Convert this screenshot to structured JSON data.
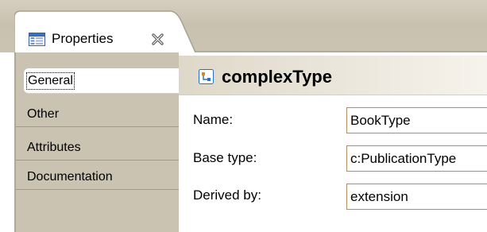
{
  "view": {
    "tab_label": "Properties",
    "tab_icon": "properties-view-icon",
    "close_icon": "close-icon"
  },
  "side_tabs": [
    {
      "label": "General",
      "active": true
    },
    {
      "label": "Other",
      "active": false
    },
    {
      "label": "Attributes",
      "active": false
    },
    {
      "label": "Documentation",
      "active": false
    }
  ],
  "section": {
    "icon": "complex-type-icon",
    "title": "complexType"
  },
  "fields": {
    "name": {
      "label": "Name:",
      "value": "BookType"
    },
    "base_type": {
      "label": "Base type:",
      "value": "c:PublicationType"
    },
    "derived_by": {
      "label": "Derived by:",
      "value": "extension"
    }
  },
  "colors": {
    "chrome": "#cbc3b2",
    "input_border": "#b08f5a",
    "icon_blue": "#2f6fbf"
  }
}
